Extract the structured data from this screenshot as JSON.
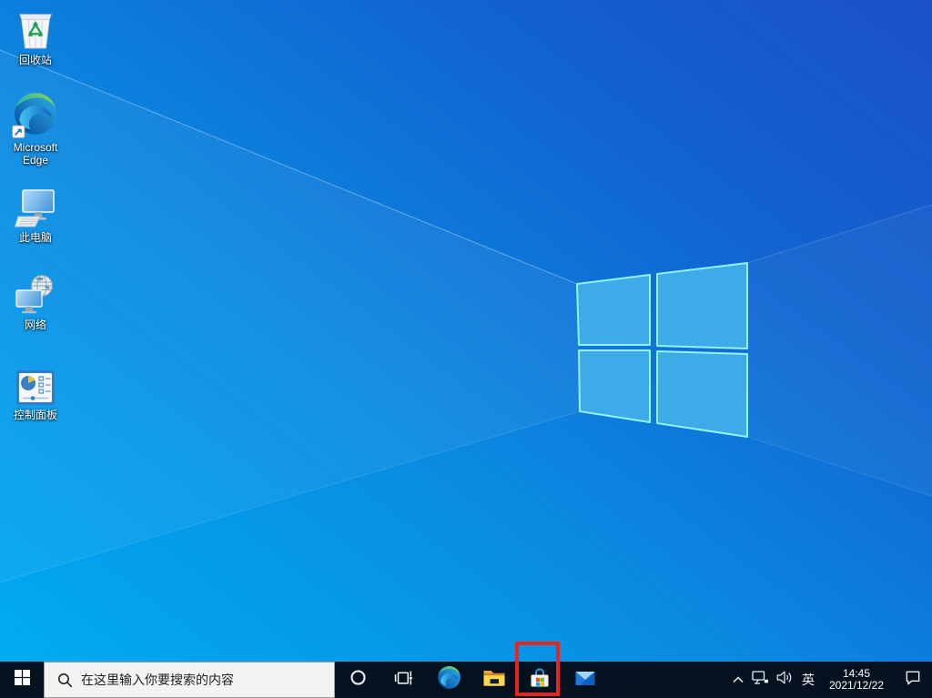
{
  "desktop": {
    "icons": [
      {
        "id": "recycle-bin",
        "label": "回收站"
      },
      {
        "id": "microsoft-edge",
        "label": "Microsoft Edge"
      },
      {
        "id": "this-pc",
        "label": "此电脑"
      },
      {
        "id": "network",
        "label": "网络"
      },
      {
        "id": "control-panel",
        "label": "控制面板"
      }
    ]
  },
  "taskbar": {
    "search": {
      "placeholder": "在这里输入你要搜索的内容"
    },
    "app_icons": [
      "cortana",
      "task-view",
      "edge",
      "file-explorer",
      "microsoft-store",
      "mail"
    ],
    "tray": {
      "ime_label": "英",
      "time": "14:45",
      "date": "2021/12/22"
    }
  },
  "annotation": {
    "highlight_target": "microsoft-store-taskbar-icon",
    "highlight_color": "#e62420"
  },
  "colors": {
    "wallpaper_bottom_left": "#00adf4",
    "wallpaper_top_right": "#1b50c6",
    "taskbar_background": "#041220",
    "logo_fill": "#3dabe8",
    "logo_stroke": "#94f1fd"
  }
}
